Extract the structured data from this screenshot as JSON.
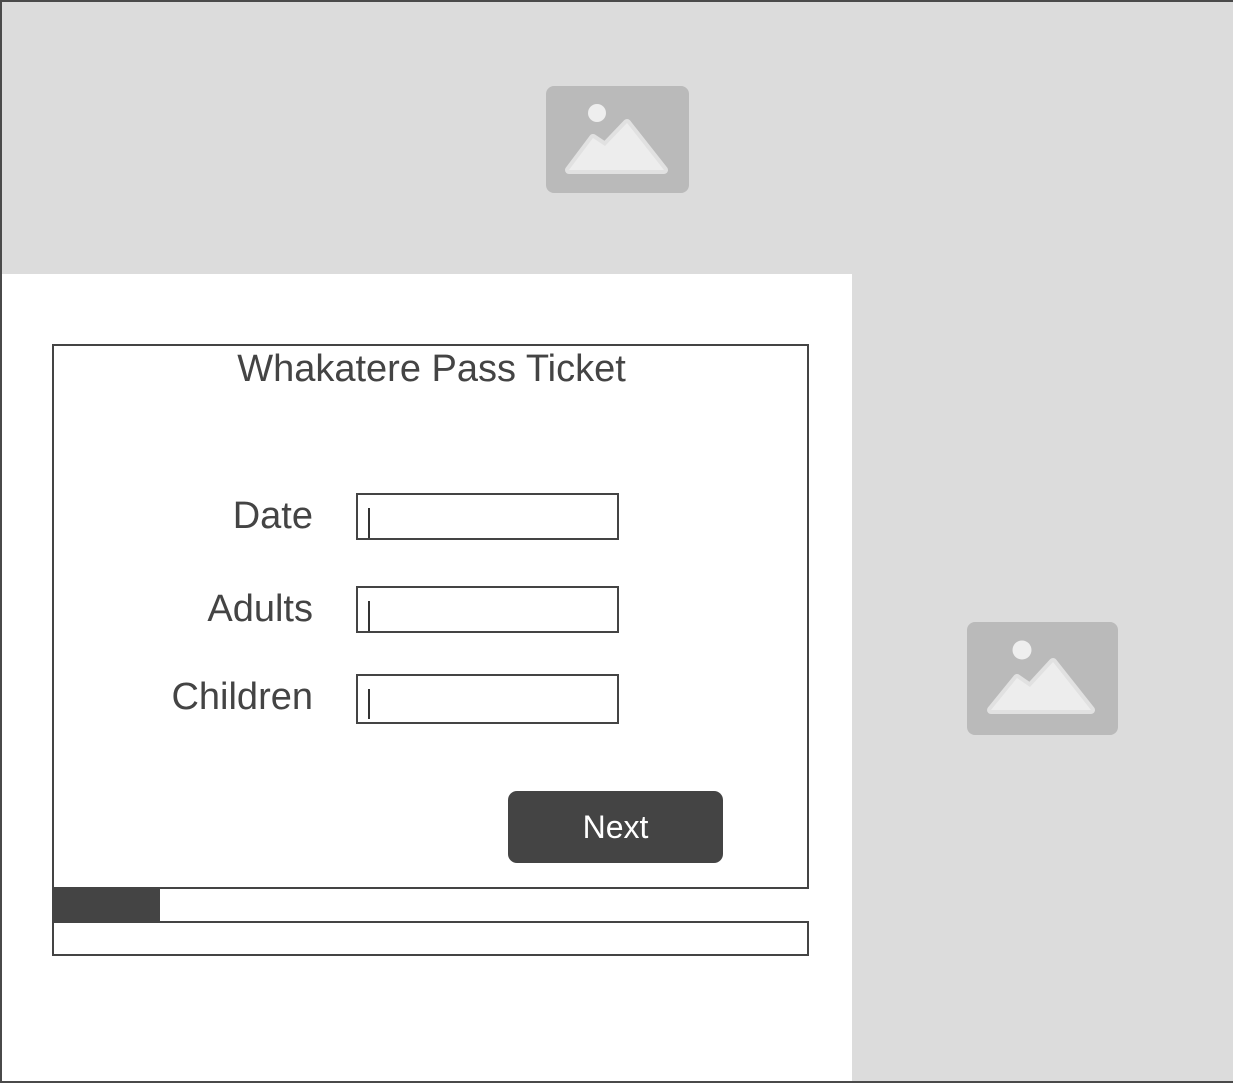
{
  "hero": {
    "image_icon": "image-placeholder-icon"
  },
  "side_panel": {
    "image_icon": "image-placeholder-icon"
  },
  "form": {
    "title": "Whakatere Pass Ticket",
    "fields": [
      {
        "label": "Date",
        "value": "",
        "placeholder": ""
      },
      {
        "label": "Adults",
        "value": "",
        "placeholder": ""
      },
      {
        "label": "Children",
        "value": "",
        "placeholder": ""
      }
    ],
    "next_label": "Next",
    "progress_fraction": 0.14
  },
  "colors": {
    "placeholder_bg": "#dcdcdc",
    "placeholder_icon": "#bababa",
    "ink": "#444444"
  }
}
